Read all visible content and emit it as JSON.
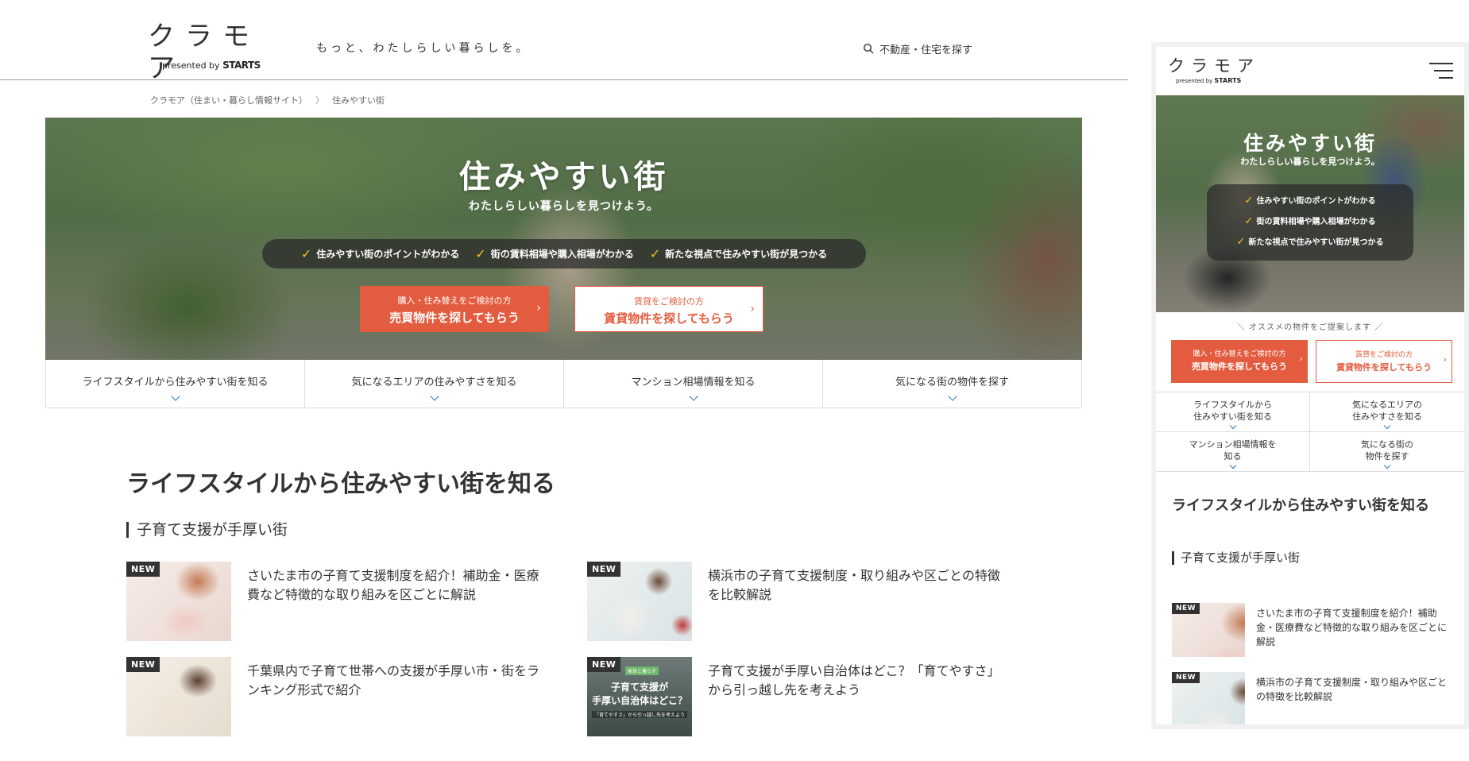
{
  "site": {
    "logo_text": "クラモア",
    "presented_by": "presented by",
    "brand": "STARTS",
    "tagline": "もっと、わたしらしい暮らしを。",
    "search_label": "不動産・住宅を探す"
  },
  "breadcrumb": {
    "home": "クラモア（住まい・暮らし情報サイト）",
    "separator": "〉",
    "current": "住みやすい街"
  },
  "hero": {
    "title": "住みやすい街",
    "subtitle": "わたしらしい暮らしを見つけよう。",
    "points": [
      "住みやすい街のポイントがわかる",
      "街の賃料相場や購入相場がわかる",
      "新たな視点で住みやすい街が見つかる"
    ],
    "check_mark": "✓",
    "buy_button": {
      "small": "購入・住み替えをご検討の方",
      "big": "売買物件を探してもらう"
    },
    "rent_button": {
      "small": "賃貸をご検討の方",
      "big": "賃貸物件を探してもらう"
    },
    "arrow": "›"
  },
  "nav": [
    "ライフスタイルから住みやすい街を知る",
    "気になるエリアの住みやすさを知る",
    "マンション相場情報を知る",
    "気になる街の物件を探す"
  ],
  "mobile_nav": [
    [
      "ライフスタイルから",
      "住みやすい街を知る"
    ],
    [
      "気になるエリアの",
      "住みやすさを知る"
    ],
    [
      "マンション相場情報を",
      "知る"
    ],
    [
      "気になる街の",
      "物件を探す"
    ]
  ],
  "recommend_text": "＼ オススメの物件をご提案します ／",
  "section": {
    "title": "ライフスタイルから住みやすい街を知る",
    "subsection": "子育て支援が手厚い街"
  },
  "new_badge": "NEW",
  "articles": [
    {
      "title": "さいたま市の子育て支援制度を紹介！補助金・医療費など特徴的な取り組みを区ごとに解説"
    },
    {
      "title": "横浜市の子育て支援制度・取り組みや区ごとの特徴を比較解説"
    },
    {
      "title": "千葉県内で子育て世帯への支援が手厚い市・街をランキング形式で紹介"
    },
    {
      "title": "子育て支援が手厚い自治体はどこ？「育てやすさ」から引っ越し先を考えよう"
    }
  ],
  "thumb4": {
    "tag": "家族と暮らす",
    "line1": "子育て支援が",
    "line2": "手厚い自治体はどこ？",
    "caption": "「育てやすさ」から引っ越し先を考えよう"
  },
  "colors": {
    "accent": "#e35c3f",
    "check": "#f4c21b",
    "chevron": "#2a74b5",
    "text": "#333333"
  },
  "icons": {
    "search": "search-icon",
    "menu": "hamburger-menu-icon",
    "chevron": "chevron-down-icon",
    "check": "check-icon"
  }
}
